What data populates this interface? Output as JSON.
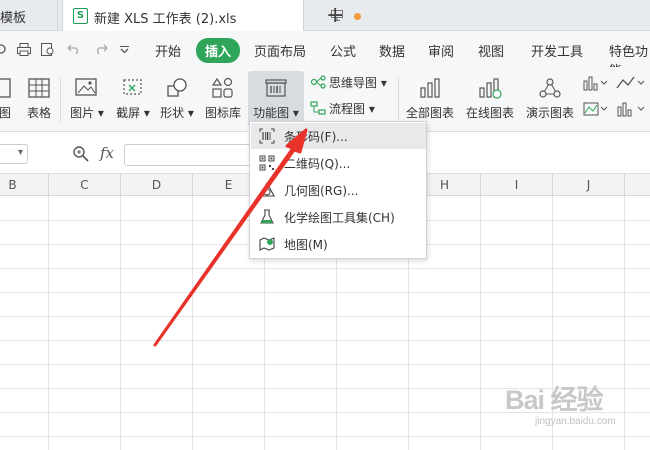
{
  "tabs": {
    "prev_label": "模板",
    "active_label": "新建 XLS 工作表 (2).xls",
    "new_tab_symbol": "+"
  },
  "menu": {
    "items": [
      "开始",
      "插入",
      "页面布局",
      "公式",
      "数据",
      "审阅",
      "视图",
      "开发工具",
      "特色功能"
    ],
    "active_index": 1
  },
  "toolbar": {
    "tools": [
      {
        "label": "图",
        "icon": "pivot-chart-icon"
      },
      {
        "label": "表格",
        "icon": "table-icon"
      },
      {
        "label": "图片",
        "icon": "picture-icon"
      },
      {
        "label": "截屏",
        "icon": "screenshot-icon"
      },
      {
        "label": "形状",
        "icon": "shape-icon"
      },
      {
        "label": "图标库",
        "icon": "icon-library-icon"
      },
      {
        "label": "功能图",
        "icon": "function-chart-icon"
      },
      {
        "label": "全部图表",
        "icon": "all-charts-icon"
      },
      {
        "label": "在线图表",
        "icon": "online-chart-icon"
      },
      {
        "label": "演示图表",
        "icon": "demo-chart-icon"
      }
    ],
    "mindmap_label": "思维导图",
    "flowchart_label": "流程图"
  },
  "formula_bar": {
    "fx_label": "fx",
    "value": ""
  },
  "columns": [
    "B",
    "C",
    "D",
    "E",
    "F",
    "G",
    "H",
    "I",
    "J"
  ],
  "dropdown": {
    "items": [
      {
        "label": "条形码(F)...",
        "icon": "barcode-icon"
      },
      {
        "label": "二维码(Q)...",
        "icon": "qrcode-icon"
      },
      {
        "label": "几何图(RG)...",
        "icon": "geometry-icon"
      },
      {
        "label": "化学绘图工具集(CH)",
        "icon": "flask-icon"
      },
      {
        "label": "地图(M)",
        "icon": "map-icon"
      }
    ],
    "hover_index": 0
  },
  "watermark": {
    "logo": "Bai 经验",
    "url": "jingyan.baidu.com"
  },
  "colors": {
    "accent": "#2fa55a",
    "arrow": "#e8322a"
  }
}
